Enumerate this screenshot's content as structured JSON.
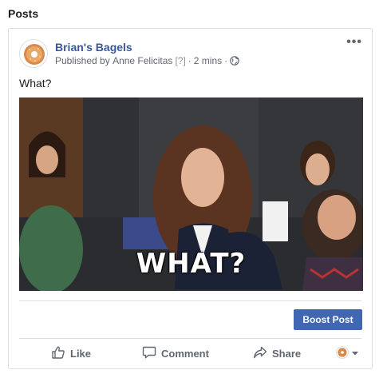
{
  "section": {
    "title": "Posts"
  },
  "post": {
    "page_name": "Brian's Bagels",
    "published_prefix": "Published by",
    "publisher": "Anne Felicitas",
    "help_marker": "[?]",
    "separator": "·",
    "time": "2 mins",
    "privacy_icon": "globe-icon",
    "menu_icon": "more-options-icon",
    "text": "What?",
    "media": {
      "caption": "WHAT?"
    },
    "boost_label": "Boost Post",
    "actions": {
      "like": "Like",
      "comment": "Comment",
      "share": "Share"
    }
  },
  "colors": {
    "brand_blue": "#4267b2",
    "link_blue": "#385898",
    "muted_text": "#606770",
    "divider": "#dadde1"
  }
}
